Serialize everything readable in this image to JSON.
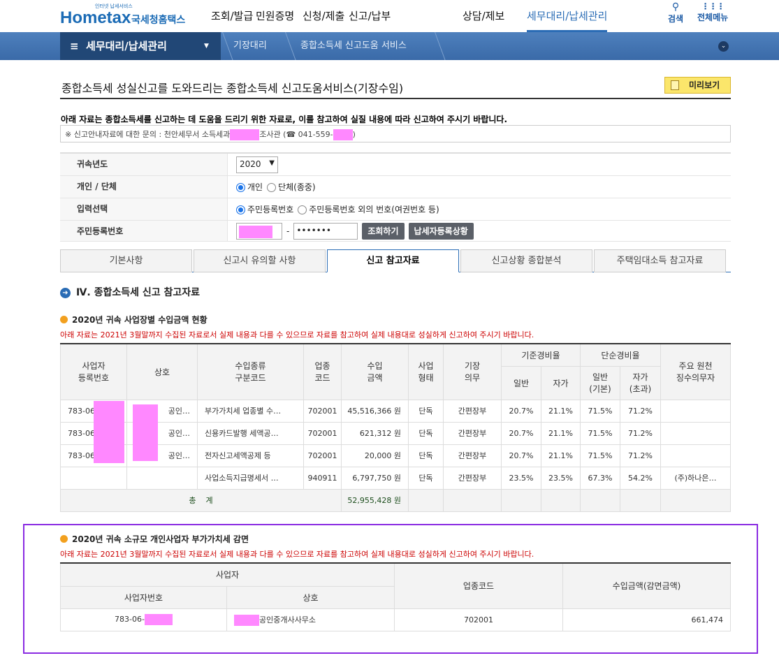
{
  "header": {
    "logo_text": "Hometax",
    "logo_korean": "국세청홈택스",
    "logo_sub": "인터넷 납세서비스",
    "nav": [
      "조회/발급",
      "민원증명",
      "신청/제출",
      "신고/납부",
      "상담/제보",
      "세무대리/납세관리"
    ],
    "search": "검색",
    "all_menu": "전체메뉴"
  },
  "breadcrumb": {
    "home": "세무대리/납세관리",
    "items": [
      "기장대리",
      "종합소득세 신고도움 서비스"
    ]
  },
  "page": {
    "title": "종합소득세 성실신고를 도와드리는 종합소득세 신고도움서비스(기장수임)",
    "preview": "미리보기",
    "notice": "아래 자료는 종합소득세를 신고하는 데 도움을 드리기 위한 자료로, 이를 참고하여 실질 내용에 따라 신고하여 주시기 바랍니다.",
    "inquiry_prefix": "※ 신고안내자료에 대한 문의 : 천안세무서 소득세과",
    "inquiry_mid": "조사관 (☎ 041-559-",
    "inquiry_end": ")"
  },
  "form": {
    "year_label": "귀속년도",
    "year": "2020",
    "type_label": "개인 / 단체",
    "type_opts": [
      "개인",
      "단체(종중)"
    ],
    "input_label": "입력선택",
    "input_opts": [
      "주민등록번호",
      "주민등록번호 외의 번호(여권번호 등)"
    ],
    "rrn_label": "주민등록번호",
    "rrn_dash": "-",
    "rrn_back": "•••••••",
    "search_btn": "조회하기",
    "status_btn": "납세자등록상황"
  },
  "tabs": [
    "기본사항",
    "신고시 유의할 사항",
    "신고 참고자료",
    "신고상황 종합분석",
    "주택임대소득 참고자료"
  ],
  "section": {
    "num": "Ⅳ",
    "title": "Ⅳ. 종합소득세 신고 참고자료"
  },
  "income": {
    "title": "2020년 귀속 사업장별 수입금액 현황",
    "note": "아래 자료는 2021년 3월말까지 수집된 자료로서 실제 내용과 다를 수 있으므로 자료를 참고하여 실제 내용대로 성실하게 신고하여 주시기 바랍니다.",
    "headers": {
      "bizno": "사업자\n등록번호",
      "name": "상호",
      "kind": "수입종류\n구분코드",
      "code": "업종\n코드",
      "amount": "수입\n금액",
      "form": "사업\n형태",
      "duty": "기장\n의무",
      "std": "기준경비율",
      "simple": "단순경비율",
      "std_gen": "일반",
      "std_self": "자가",
      "sim_gen": "일반\n(기본)",
      "sim_self": "자가\n(초과)",
      "withholder": "주요 원천\n징수의무자"
    },
    "rows": [
      [
        "783-06",
        "공인…",
        "부가가치세 업종별 수…",
        "702001",
        "45,516,366 원",
        "단독",
        "간편장부",
        "20.7%",
        "21.1%",
        "71.5%",
        "71.2%",
        ""
      ],
      [
        "783-06",
        "공인…",
        "신용카드발행 세액공…",
        "702001",
        "621,312 원",
        "단독",
        "간편장부",
        "20.7%",
        "21.1%",
        "71.5%",
        "71.2%",
        ""
      ],
      [
        "783-06",
        "공인…",
        "전자신고세액공제 등",
        "702001",
        "20,000 원",
        "단독",
        "간편장부",
        "20.7%",
        "21.1%",
        "71.5%",
        "71.2%",
        ""
      ],
      [
        "",
        "",
        "사업소득지급명세서 …",
        "940911",
        "6,797,750 원",
        "단독",
        "간편장부",
        "23.5%",
        "23.5%",
        "67.3%",
        "54.2%",
        "(주)하나은…"
      ]
    ],
    "total_label": "총    계",
    "total": "52,955,428 원"
  },
  "vat": {
    "title": "2020년 귀속 소규모 개인사업자 부가가치세 감면",
    "note": "아래 자료는 2021년 3월말까지 수집된 자료로서 실제 내용과 다를 수 있으므로 자료를 참고하여 실제 내용대로 성실하게 신고하여 주시기 바랍니다.",
    "headers": {
      "biz": "사업자",
      "bizno": "사업자번호",
      "name": "상호",
      "code": "업종코드",
      "amount": "수입금액(감면금액)"
    },
    "row": {
      "bizno": "783-06-",
      "name": "공인중개사사무소",
      "code": "702001",
      "amount": "661,474"
    }
  }
}
